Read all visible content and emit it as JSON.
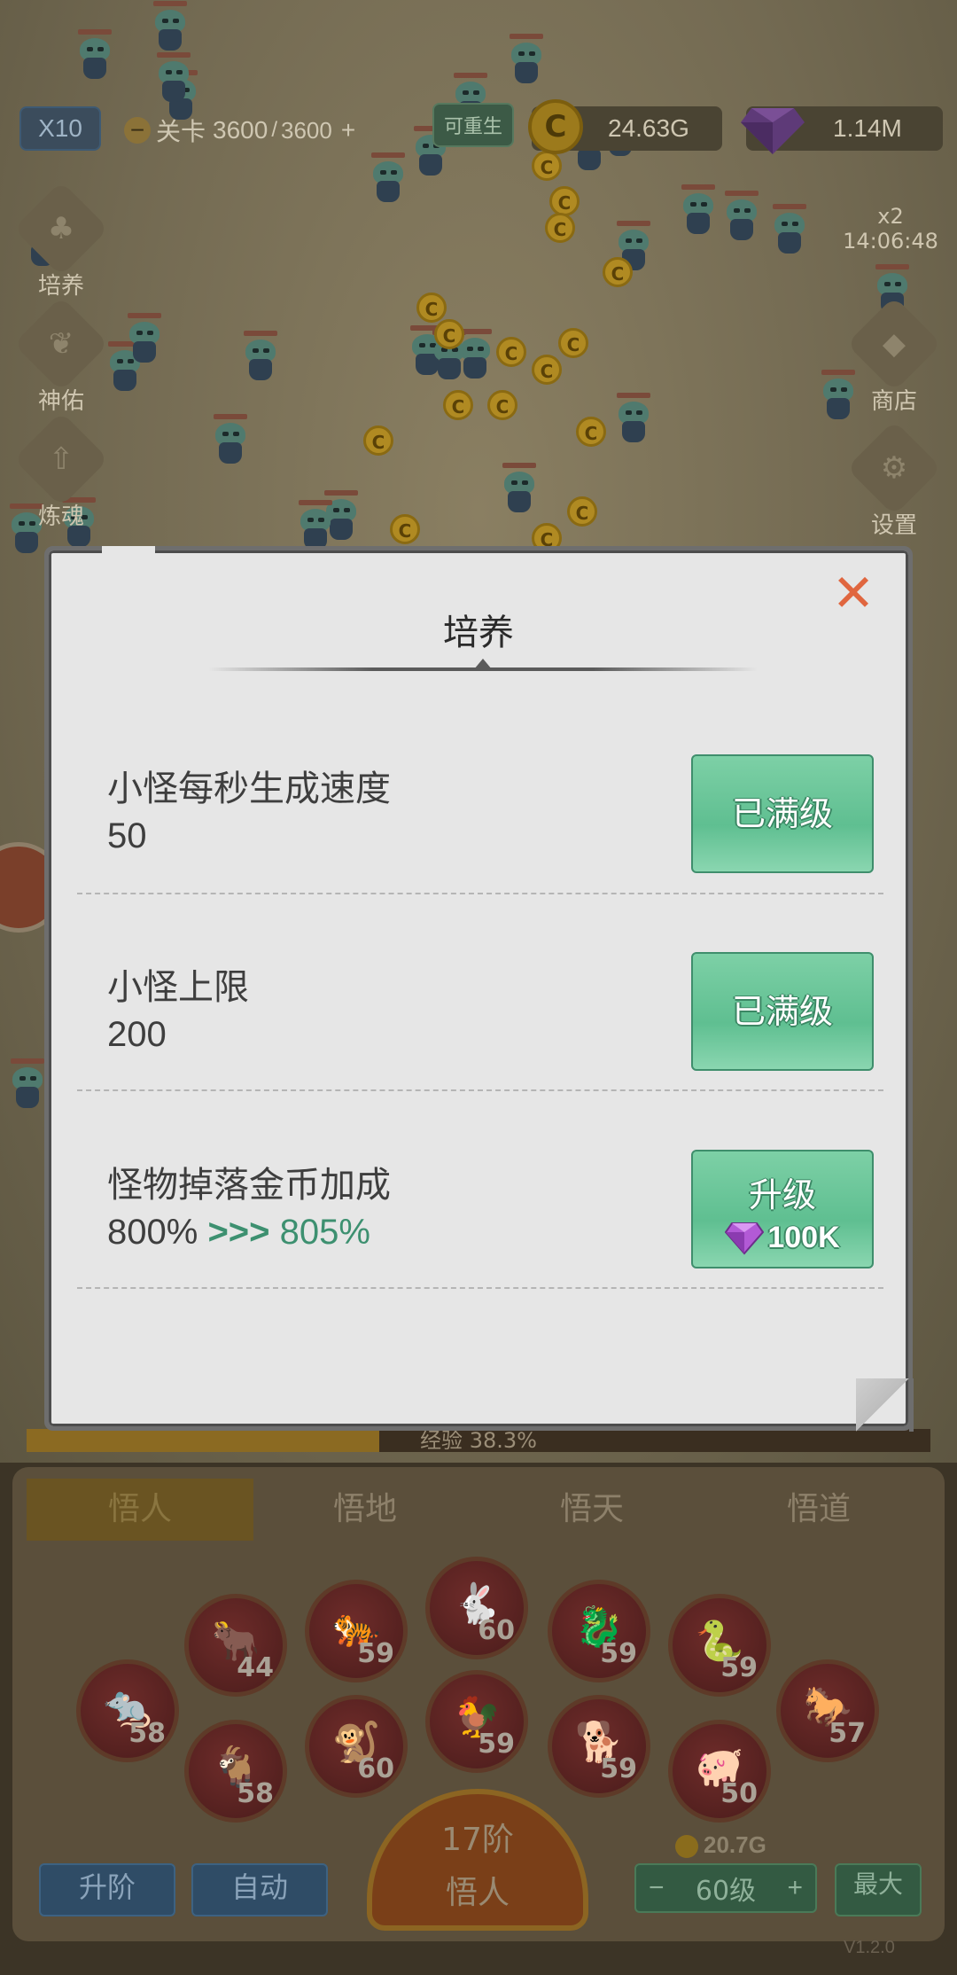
{
  "hud": {
    "multiplier": "X10",
    "stage_label": "关卡",
    "stage_current": "3600",
    "stage_max": "3600",
    "stage_plus": "+",
    "rebirth": "可重生",
    "gold": "24.63G",
    "gems": "1.14M",
    "speed_badge": "x2",
    "timer": "14:06:48"
  },
  "side_left": [
    "培养",
    "神佑",
    "炼魂"
  ],
  "side_right": [
    "商店",
    "设置"
  ],
  "dialog": {
    "title": "培养",
    "close_glyph": "✕",
    "rows": [
      {
        "name": "小怪每秒生成速度",
        "value": "50",
        "button": "已满级"
      },
      {
        "name": "小怪上限",
        "value": "200",
        "button": "已满级"
      },
      {
        "name": "怪物掉落金币加成",
        "value": "800%",
        "arrow": ">>>",
        "next": "805%",
        "button": "升级",
        "cost": "100K"
      }
    ]
  },
  "bottom": {
    "exp": "经验 38.3%",
    "tabs": [
      "悟人",
      "悟地",
      "悟天",
      "悟道"
    ],
    "zodiac_levels": [
      "58",
      "44",
      "58",
      "59",
      "60",
      "60",
      "59",
      "59",
      "59",
      "59",
      "50",
      "57"
    ],
    "stage_rank": "17阶",
    "stage_name": "悟人",
    "cost": "20.7G",
    "buttons": {
      "upgrade_stage": "升阶",
      "auto": "自动",
      "level": "60级",
      "max": "最大",
      "minus": "−",
      "plus": "+"
    },
    "version": "V1.2.0"
  },
  "colors": {
    "accent_green": "#5fbf91",
    "close_orange": "#e0663f",
    "highlight_green": "#3d9070"
  }
}
